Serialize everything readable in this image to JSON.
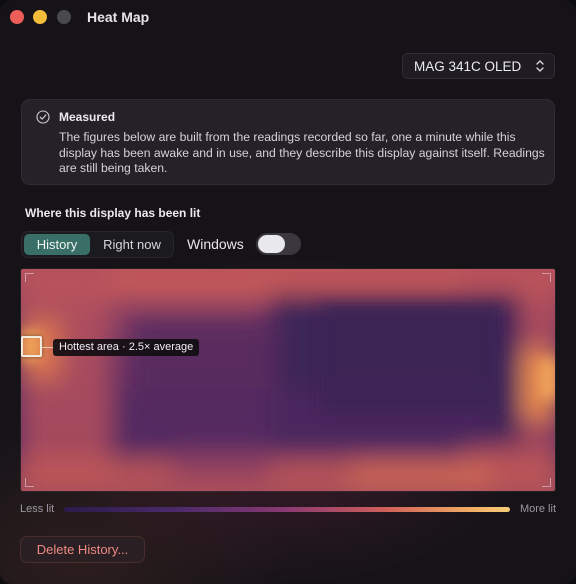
{
  "window": {
    "title": "Heat Map"
  },
  "display_picker": {
    "selected": "MAG 341C OLED"
  },
  "info": {
    "title": "Measured",
    "body": "The figures below are built from the readings recorded so far, one a minute while this display has been awake and in use, and they describe this display against itself. Readings are still being taken."
  },
  "section": {
    "title": "Where this display has been lit"
  },
  "mode": {
    "options": [
      "History",
      "Right now"
    ],
    "selected": "History"
  },
  "windows_toggle": {
    "label": "Windows",
    "on": false
  },
  "heatmap": {
    "hotspot_label": "Hottest area · 2.5× average"
  },
  "legend": {
    "less": "Less lit",
    "more": "More lit",
    "colors": [
      "#2a1c4a",
      "#4b2a6c",
      "#8b3a72",
      "#cf5f5a",
      "#f3b063",
      "#f7cd78"
    ]
  },
  "actions": {
    "delete_label": "Delete History..."
  },
  "colors": {
    "accent": "#3a6f68",
    "danger": "#ee8a86"
  }
}
